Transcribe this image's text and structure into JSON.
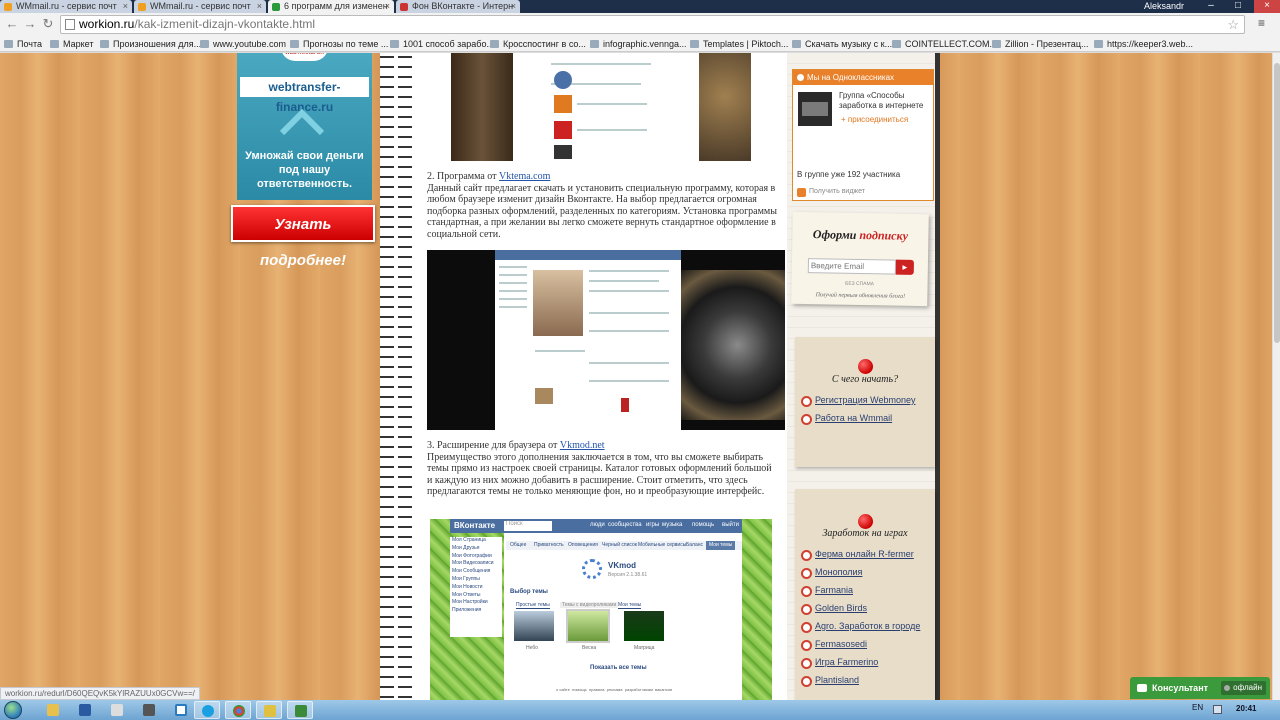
{
  "browser": {
    "tabs": [
      {
        "title": "WMmail.ru - сервис почт",
        "active": false
      },
      {
        "title": "WMmail.ru - сервис почт",
        "active": false
      },
      {
        "title": "6 программ для изменен",
        "active": true
      },
      {
        "title": "Фон ВКонтакте - Интерн",
        "active": false
      }
    ],
    "user": "Aleksandr",
    "url_host": "workion.ru",
    "url_path": "/kak-izmenit-dizajn-vkontakte.html",
    "bookmarks": [
      "Почта",
      "Маркет",
      "Произношения для...",
      "www.youtube.com",
      "Прогнозы по теме ...",
      "1001 способ зарабо...",
      "Кросспостинг в со...",
      "infographic.vennga...",
      "Templates | Piktoch...",
      "Скачать музыку с к...",
      "COINTELLECT.COM...",
      "Zillion - Презентац...",
      "https://keeper3.web..."
    ]
  },
  "banner": {
    "logo": "WEBTRANSFER",
    "site": "webtransfer-finance.ru",
    "tagline": "Умножай свои деньги под нашу ответственность.",
    "cta": "Узнать подробнее!"
  },
  "article": {
    "item2_number": "2. Программа от ",
    "item2_link": "Vktema.com",
    "item2_body": "Данный сайт предлагает скачать и установить специальную программу, которая в любом браузере изменит дизайн Вконтакте. На выбор предлагается огромная подборка разных оформлений, разделенных по категориям. Установка программы стандартная, а при желании вы легко сможете вернуть стандартное оформление в социальной сети.",
    "item3_number": "3. Расширение для браузера от ",
    "item3_link": "Vkmod.net",
    "item3_body": "Преимущество этого дополнения заключается в том, что вы сможете выбирать темы прямо из настроек своей страницы. Каталог готовых оформлений большой и каждую из них можно добавить в расширение. Стоит отметить, что здесь предлагаются темы не только меняющие фон, но и преобразующие интерфейс.",
    "vkmod_shot": {
      "brand": "ВКонтакте",
      "search": "Поиск",
      "nav": [
        "люди",
        "сообщества",
        "игры",
        "музыка",
        "помощь",
        "выйти"
      ],
      "menu": [
        "Моя Страница",
        "Мои Друзья",
        "Мои Фотографии",
        "Мои Видеозаписи",
        "Мои Сообщения",
        "Мои Группы",
        "Мои Новости",
        "Мои Ответы",
        "Мои Настройки",
        "Приложения"
      ],
      "tabs": [
        "Общее",
        "Приватность",
        "Оповещения",
        "Черный список",
        "Мобильные сервисы",
        "Баланс",
        "Мои темы"
      ],
      "title": "VKmod",
      "version": "Версия 2.1.38.61",
      "section": "Выбор темы",
      "subtabs": [
        "Простые темы",
        "Темы с видеороликами",
        "Мои темы"
      ],
      "themes": [
        "Небо",
        "Весна",
        "Матрица"
      ],
      "show_all": "Показать все темы",
      "footer": "о сайте  помощь  правила  реклама  разработчикам  вакансии"
    }
  },
  "sidebar": {
    "ok": {
      "header": "Мы на Одноклассниках",
      "group": "Группа «Способы заработка в интернете",
      "join": "присоединиться",
      "count": "В группе уже 192 участника",
      "widget": "Получить виджет"
    },
    "subscribe": {
      "title_a": "Оформи ",
      "title_b": "подписку",
      "placeholder": "Введите Email",
      "go": "►",
      "nospam": "БЕЗ СПАМА",
      "note": "Получай первым обновления блога!"
    },
    "start": {
      "title": "С чего начать?",
      "links": [
        "Регистрация Webmoney",
        "Работа на Wmmail"
      ]
    },
    "games": {
      "title": "Заработок на играх",
      "links": [
        "Ферма онлайн R-fermer",
        "Монополия",
        "Farmania",
        "Golden Birds",
        "Agro. Заработок в городе",
        "Fermasosedi",
        "Игра Farmerino",
        "Plantisland"
      ]
    }
  },
  "status_url": "workion.ru/redurl/D60QEQvK5kYlRAZUUx0GCVw==/",
  "consultant": {
    "label": "Консультант",
    "status": "офлайн"
  },
  "taskbar": {
    "lang": "EN",
    "time": "20:41"
  },
  "colors": {
    "ok_orange": "#e9802a",
    "link_blue": "#2255aa",
    "pin_red": "#cc0000",
    "consultant_green": "#3b9a3b"
  }
}
